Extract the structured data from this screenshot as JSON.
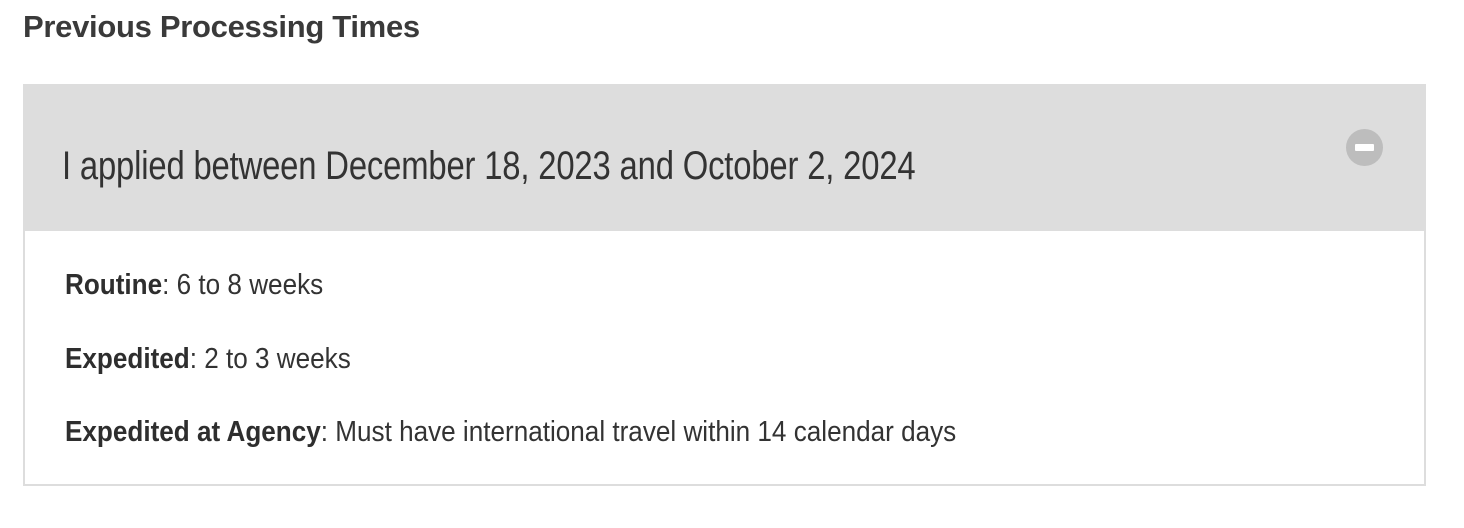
{
  "section": {
    "heading": "Previous Processing Times"
  },
  "accordion": {
    "title": "I applied between December 18, 2023 and October 2, 2024",
    "toggle_icon": "minus-circle-icon",
    "expanded": true,
    "items": [
      {
        "label": "Routine",
        "value": ": 6 to 8 weeks"
      },
      {
        "label": "Expedited",
        "value": ": 2 to 3 weeks"
      },
      {
        "label": "Expedited at Agency",
        "value": ": Must have international travel within 14 calendar days"
      }
    ]
  },
  "colors": {
    "header_bg": "#dddddd",
    "icon_bg": "#bdbdbd",
    "text": "#333333",
    "border": "#dddddd"
  }
}
